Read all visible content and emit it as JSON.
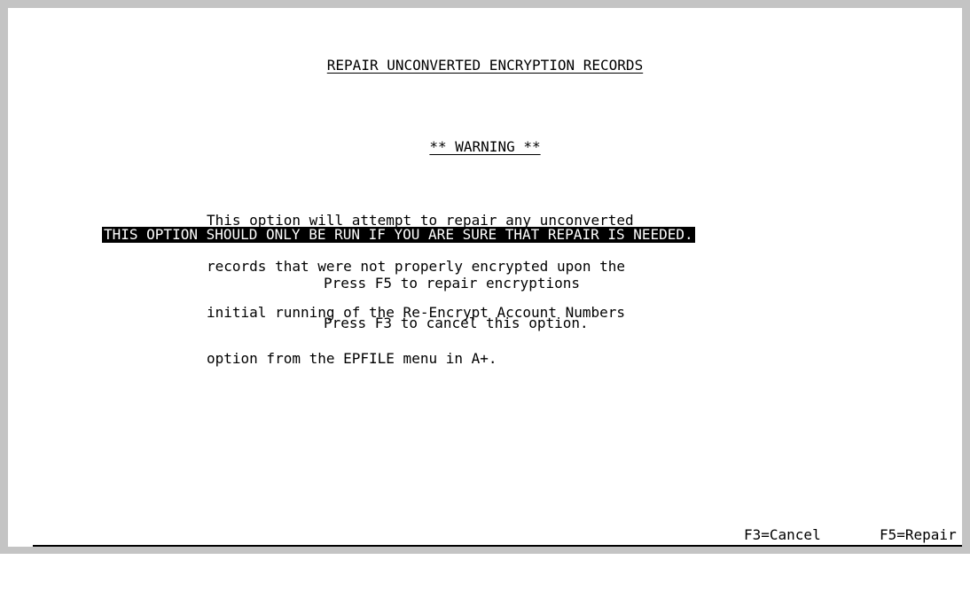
{
  "screen": {
    "title": "REPAIR UNCONVERTED ENCRYPTION RECORDS",
    "warning_heading": "** WARNING **",
    "description_lines": [
      "This option will attempt to repair any unconverted",
      "records that were not properly encrypted upon the",
      "initial running of the Re-Encrypt Account Numbers",
      "option from the EPFILE menu in A+."
    ],
    "alert": "THIS OPTION SHOULD ONLY BE RUN IF YOU ARE SURE THAT REPAIR IS NEEDED.",
    "instructions": [
      "Press F5 to repair encryptions",
      "Press F3 to cancel this option."
    ]
  },
  "function_keys": {
    "cancel": "F3=Cancel",
    "repair": "F5=Repair"
  }
}
